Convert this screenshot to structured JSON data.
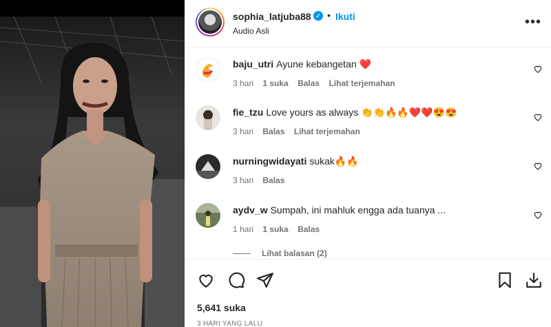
{
  "post": {
    "username": "sophia_latjuba88",
    "follow_label": "Ikuti",
    "separator": "•",
    "audio_label": "Audio Asli",
    "more_glyph": "•••",
    "verified_glyph": "✓"
  },
  "comments": [
    {
      "username": "baju_utri",
      "text": "Ayune kebangetan ❤️",
      "time": "3 hari",
      "likes": "1 suka",
      "reply": "Balas",
      "translate": "Lihat terjemahan"
    },
    {
      "username": "fie_tzu",
      "text": "Love yours as always 👏👏🔥🔥❤️❤️😍😍",
      "time": "3 hari",
      "likes": "",
      "reply": "Balas",
      "translate": "Lihat terjemahan"
    },
    {
      "username": "nurningwidayati",
      "text": "sukak🔥🔥",
      "time": "3 hari",
      "likes": "",
      "reply": "Balas",
      "translate": ""
    },
    {
      "username": "aydv_w",
      "text": "Sumpah, ini mahluk engga ada tuanya ...",
      "time": "1 hari",
      "likes": "1 suka",
      "reply": "Balas",
      "translate": ""
    }
  ],
  "view_replies": "Lihat balasan (2)",
  "actions": {
    "like_icon": "heart-icon",
    "comment_icon": "comment-icon",
    "share_icon": "share-icon",
    "save_icon": "bookmark-icon",
    "download_icon": "download-icon"
  },
  "likes_count": "5,641 suka",
  "time_ago": "3 HARI YANG LALU",
  "colors": {
    "accent": "#0095f6",
    "heart": "#ed4956",
    "muted": "#737373"
  }
}
